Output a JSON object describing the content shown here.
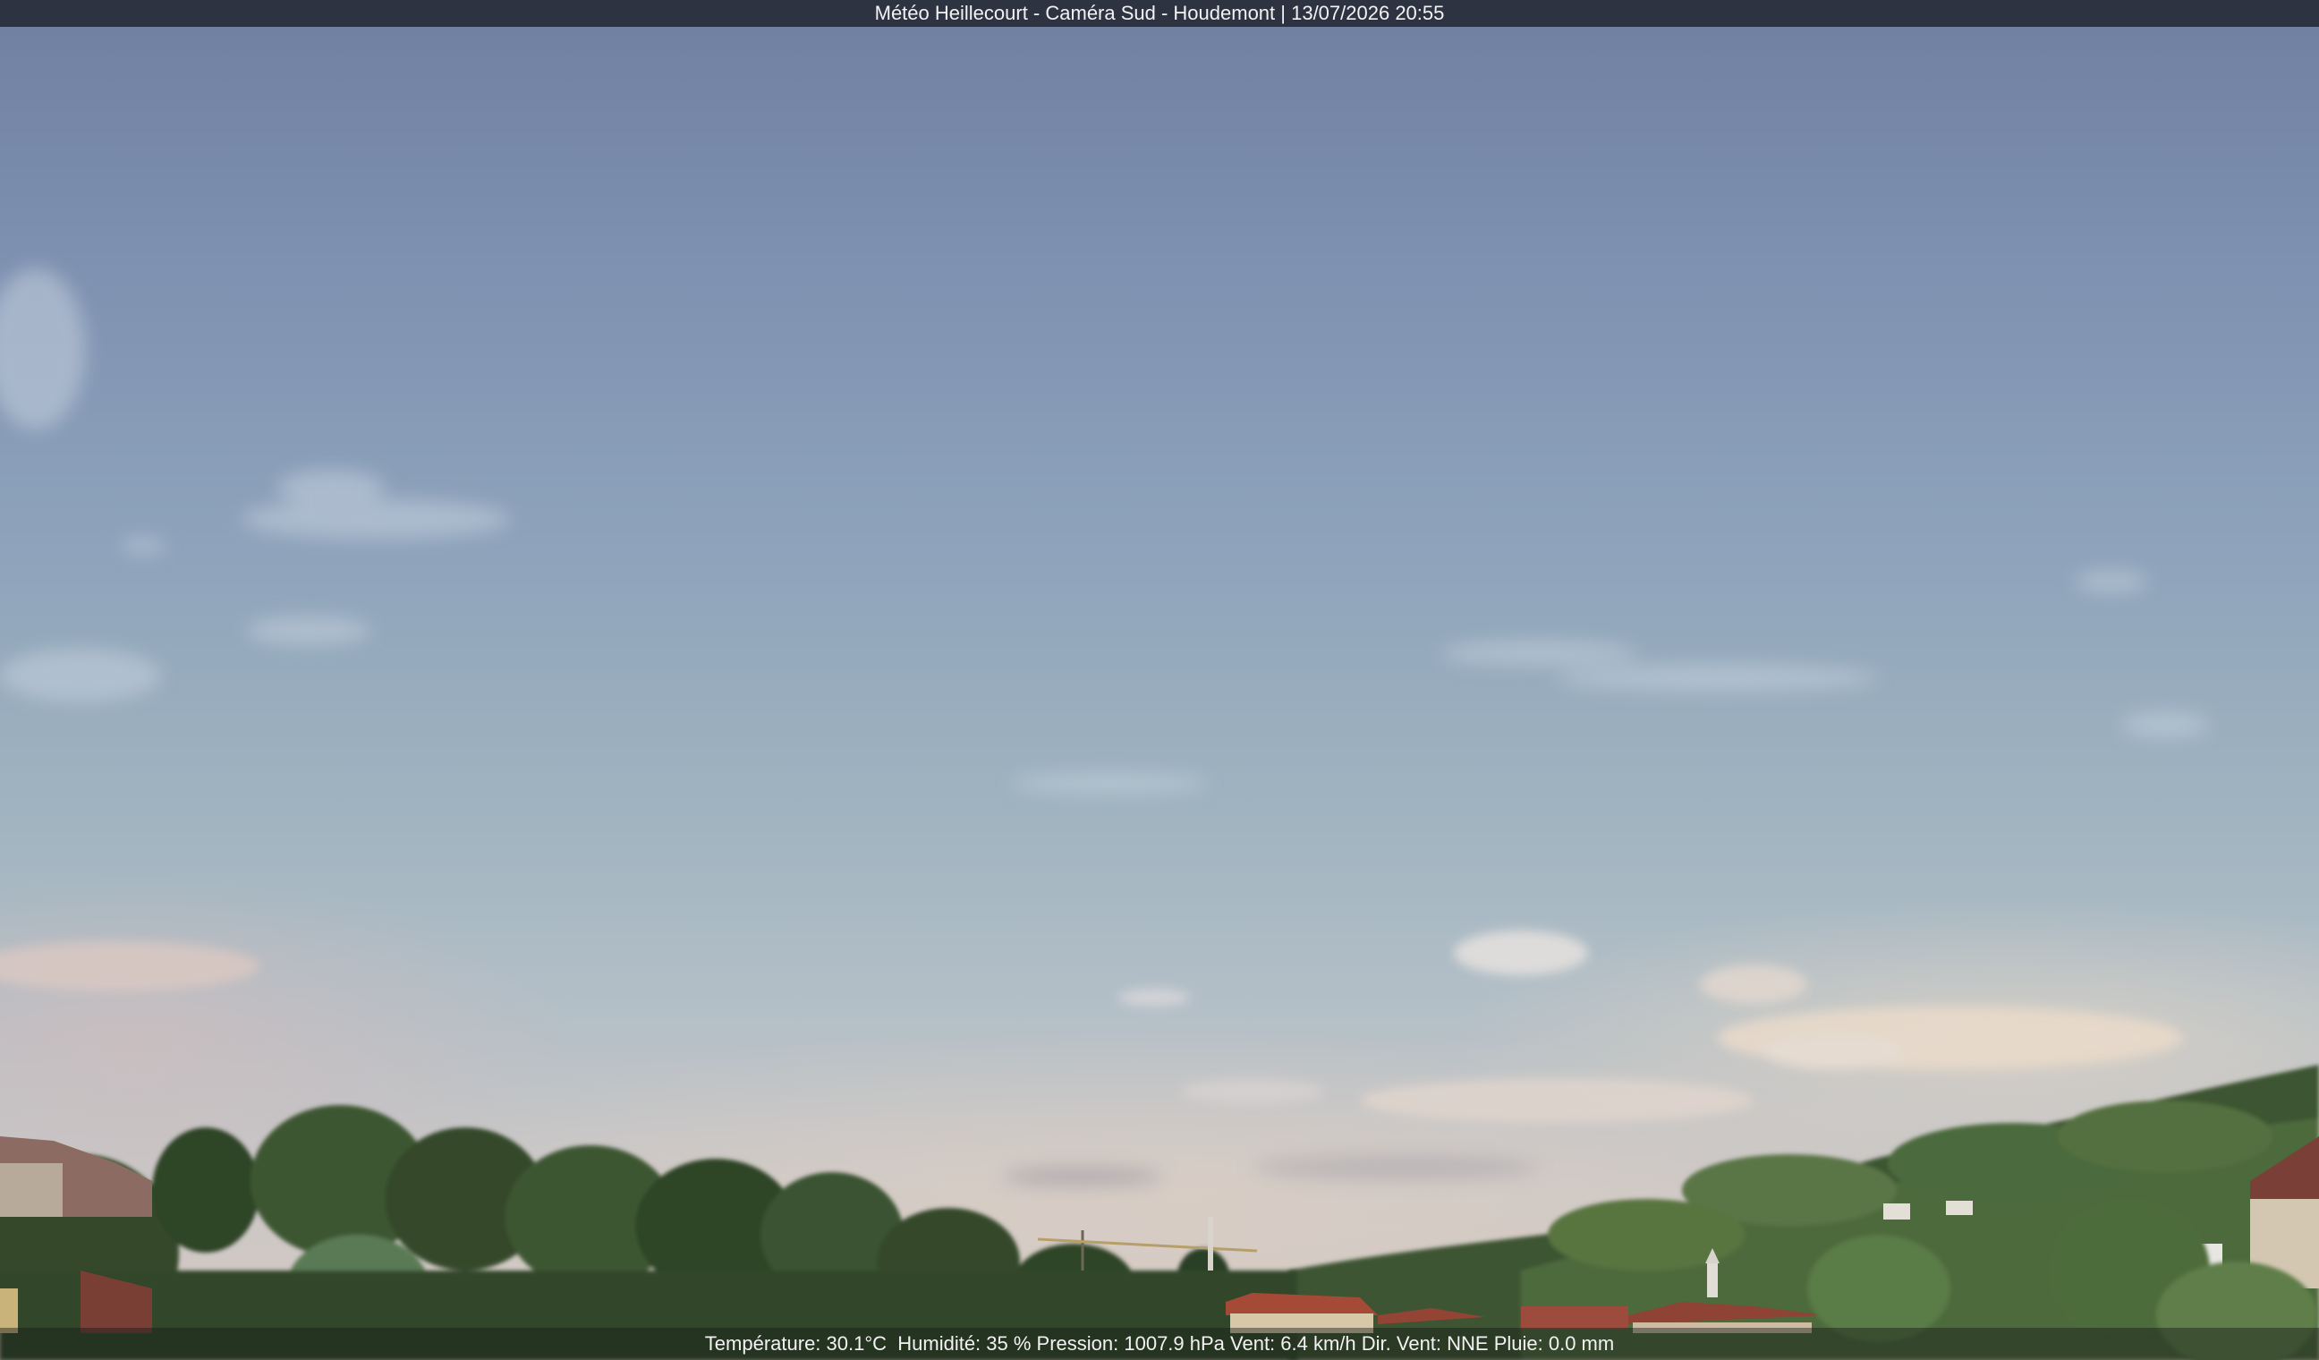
{
  "overlay": {
    "title": "Météo Heillecourt - Caméra Sud - Houdemont | 13/07/2026 20:55",
    "weather_line": "Température: 30.1°C  Humidité: 35 % Pression: 1007.9 hPa Vent: 6.4 km/h Dir. Vent: NNE Pluie: 0.0 mm"
  },
  "scene": {
    "sky_color": "#8ea3bb",
    "horizon_color": "#d7cbc3",
    "foliage_color": "#2f4a2a",
    "roof_color": "#8a4a3a"
  }
}
